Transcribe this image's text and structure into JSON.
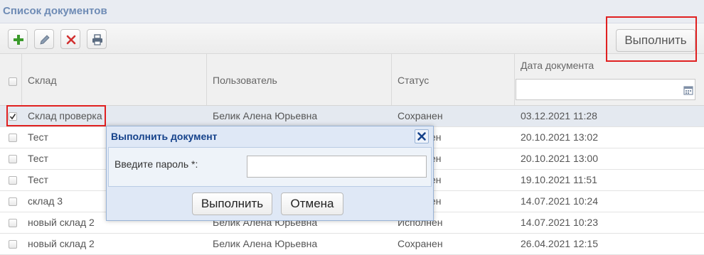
{
  "panel": {
    "title": "Список документов"
  },
  "toolbar": {
    "add": "plus-icon",
    "edit": "pencil-icon",
    "delete": "x-icon",
    "print": "printer-icon",
    "execute_label": "Выполнить"
  },
  "grid": {
    "columns": [
      "Склад",
      "Пользователь",
      "Статус",
      "Дата документа"
    ],
    "rows": [
      {
        "warehouse": "Склад проверка",
        "user": "Белик Алена Юрьевна",
        "status": "Сохранен",
        "date": "03.12.2021 11:28",
        "checked": true
      },
      {
        "warehouse": "Тест",
        "user": "",
        "status": "ен",
        "date": "20.10.2021 13:02",
        "checked": false
      },
      {
        "warehouse": "Тест",
        "user": "",
        "status": "ен",
        "date": "20.10.2021 13:00",
        "checked": false
      },
      {
        "warehouse": "Тест",
        "user": "",
        "status": "ен",
        "date": "19.10.2021 11:51",
        "checked": false
      },
      {
        "warehouse": "склад 3",
        "user": "",
        "status": "ен",
        "date": "14.07.2021 10:24",
        "checked": false
      },
      {
        "warehouse": "новый склад 2",
        "user": "Белик Алена Юрьевна",
        "status": "Исполнен",
        "date": "14.07.2021 10:23",
        "checked": false
      },
      {
        "warehouse": "новый склад 2",
        "user": "Белик Алена Юрьевна",
        "status": "Сохранен",
        "date": "26.04.2021 12:15",
        "checked": false
      }
    ]
  },
  "dialog": {
    "title": "Выполнить документ",
    "password_label": "Введите пароль *:",
    "password_value": "",
    "ok_label": "Выполнить",
    "cancel_label": "Отмена"
  },
  "colors": {
    "highlight": "#e02020",
    "dialog_title": "#15428b",
    "add_icon": "#3a9a2a",
    "delete_icon": "#d23030"
  }
}
